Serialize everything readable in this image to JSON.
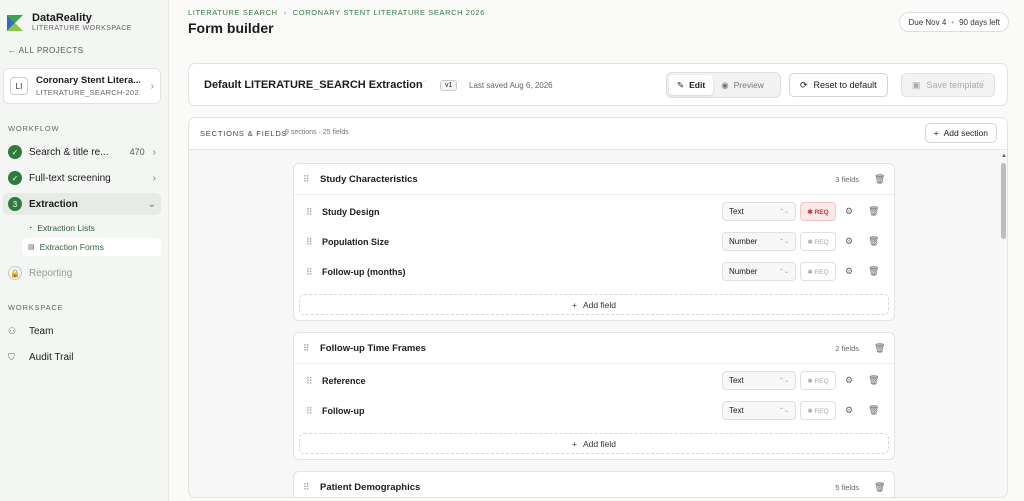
{
  "brand": {
    "name": "DataReality",
    "subtitle": "LITERATURE WORKSPACE"
  },
  "nav_back": "← ALL PROJECTS",
  "project": {
    "initials": "LI",
    "name": "Coronary Stent Litera...",
    "sub": "LITERATURE_SEARCH-202..."
  },
  "workflow_label": "WORKFLOW",
  "workflow": [
    {
      "label": "Search & title re...",
      "count": "470",
      "step": "✓"
    },
    {
      "label": "Full-text screening",
      "step": "✓"
    },
    {
      "label": "Extraction",
      "step": "3"
    },
    {
      "label": "Reporting",
      "step": "🔒"
    }
  ],
  "extraction_sub": [
    "Extraction Lists",
    "Extraction Forms"
  ],
  "workspace_label": "WORKSPACE",
  "workspace": [
    "Team",
    "Audit Trail"
  ],
  "breadcrumb": [
    "LITERATURE SEARCH",
    "CORONARY STENT LITERATURE SEARCH 2026"
  ],
  "page_title": "Form builder",
  "due": {
    "date": "Due Nov 4",
    "left": "90 days left"
  },
  "template": {
    "name": "Default LITERATURE_SEARCH Extraction Tem",
    "version": "v1",
    "saved": "Last saved Aug 6, 2026"
  },
  "toolbar": {
    "edit": "Edit",
    "preview": "Preview",
    "reset": "Reset to default",
    "save": "Save template"
  },
  "editor": {
    "title": "SECTIONS & FIELDS",
    "count": "9 sections · 25 fields",
    "add_section": "Add section",
    "add_field": "Add field",
    "req": "✱ REQ"
  },
  "sections": [
    {
      "title": "Study Characteristics",
      "count": "3 fields",
      "fields": [
        {
          "label": "Study Design",
          "type": "Text",
          "required": true
        },
        {
          "label": "Population Size",
          "type": "Number",
          "required": false
        },
        {
          "label": "Follow-up (months)",
          "type": "Number",
          "required": false
        }
      ]
    },
    {
      "title": "Follow-up Time Frames",
      "count": "2 fields",
      "fields": [
        {
          "label": "Reference",
          "type": "Text",
          "required": false
        },
        {
          "label": "Follow-up",
          "type": "Text",
          "required": false
        }
      ]
    },
    {
      "title": "Patient Demographics",
      "count": "5 fields",
      "fields": []
    }
  ],
  "colors": {
    "accent": "#2f7a3d",
    "req_bg": "#fbe9e9",
    "req_text": "#c23b3b"
  }
}
